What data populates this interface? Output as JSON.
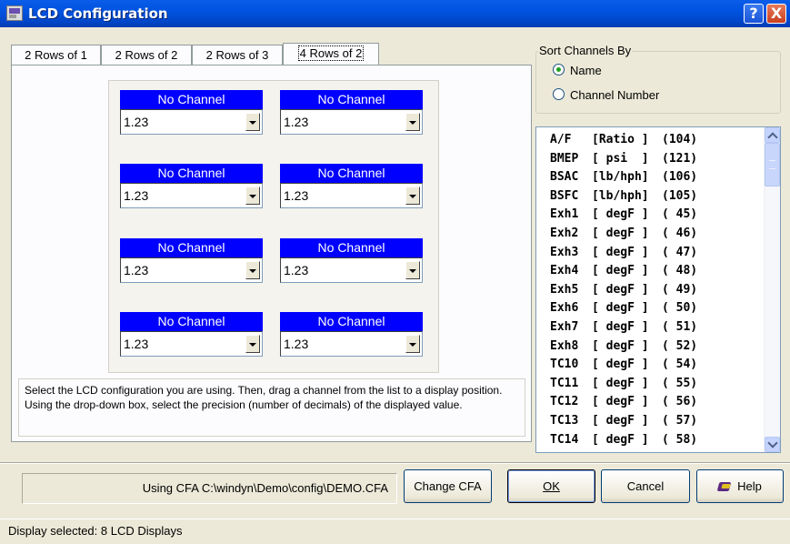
{
  "window": {
    "title": "LCD Configuration",
    "help_button": "?",
    "close_button": "X"
  },
  "tabs": [
    {
      "label": "2 Rows of 1"
    },
    {
      "label": "2 Rows of 2"
    },
    {
      "label": "2 Rows of 3"
    },
    {
      "label": "4 Rows of 2",
      "active": true
    }
  ],
  "lcd_cells": [
    {
      "header": "No Channel",
      "precision": "1.23"
    },
    {
      "header": "No Channel",
      "precision": "1.23"
    },
    {
      "header": "No Channel",
      "precision": "1.23"
    },
    {
      "header": "No Channel",
      "precision": "1.23"
    },
    {
      "header": "No Channel",
      "precision": "1.23"
    },
    {
      "header": "No Channel",
      "precision": "1.23"
    },
    {
      "header": "No Channel",
      "precision": "1.23"
    },
    {
      "header": "No Channel",
      "precision": "1.23"
    }
  ],
  "instructions": "Select the LCD configuration you are using.  Then, drag a channel from the list to a display position.  Using the drop-down box, select the precision (number of decimals) of the displayed value.",
  "sort": {
    "legend": "Sort Channels By",
    "options": [
      {
        "label": "Name",
        "selected": true
      },
      {
        "label": "Channel Number",
        "selected": false
      }
    ]
  },
  "channels": [
    {
      "name": "A/F",
      "unit": "[Ratio ]",
      "number": "(104)"
    },
    {
      "name": "BMEP",
      "unit": "[ psi  ]",
      "number": "(121)"
    },
    {
      "name": "BSAC",
      "unit": "[lb/hph]",
      "number": "(106)"
    },
    {
      "name": "BSFC",
      "unit": "[lb/hph]",
      "number": "(105)"
    },
    {
      "name": "Exh1",
      "unit": "[ degF ]",
      "number": "( 45)"
    },
    {
      "name": "Exh2",
      "unit": "[ degF ]",
      "number": "( 46)"
    },
    {
      "name": "Exh3",
      "unit": "[ degF ]",
      "number": "( 47)"
    },
    {
      "name": "Exh4",
      "unit": "[ degF ]",
      "number": "( 48)"
    },
    {
      "name": "Exh5",
      "unit": "[ degF ]",
      "number": "( 49)"
    },
    {
      "name": "Exh6",
      "unit": "[ degF ]",
      "number": "( 50)"
    },
    {
      "name": "Exh7",
      "unit": "[ degF ]",
      "number": "( 51)"
    },
    {
      "name": "Exh8",
      "unit": "[ degF ]",
      "number": "( 52)"
    },
    {
      "name": "TC10",
      "unit": "[ degF ]",
      "number": "( 54)"
    },
    {
      "name": "TC11",
      "unit": "[ degF ]",
      "number": "( 55)"
    },
    {
      "name": "TC12",
      "unit": "[ degF ]",
      "number": "( 56)"
    },
    {
      "name": "TC13",
      "unit": "[ degF ]",
      "number": "( 57)"
    },
    {
      "name": "TC14",
      "unit": "[ degF ]",
      "number": "( 58)"
    }
  ],
  "footer": {
    "cfa_path": "Using CFA C:\\windyn\\Demo\\config\\DEMO.CFA",
    "change_cfa": "Change CFA",
    "ok": "OK",
    "cancel": "Cancel",
    "help": "Help"
  },
  "status": "Display selected: 8 LCD Displays",
  "colors": {
    "titlebar": "#0053e0",
    "lcd_header": "#0000ff",
    "dialog_bg": "#ece9d8"
  }
}
